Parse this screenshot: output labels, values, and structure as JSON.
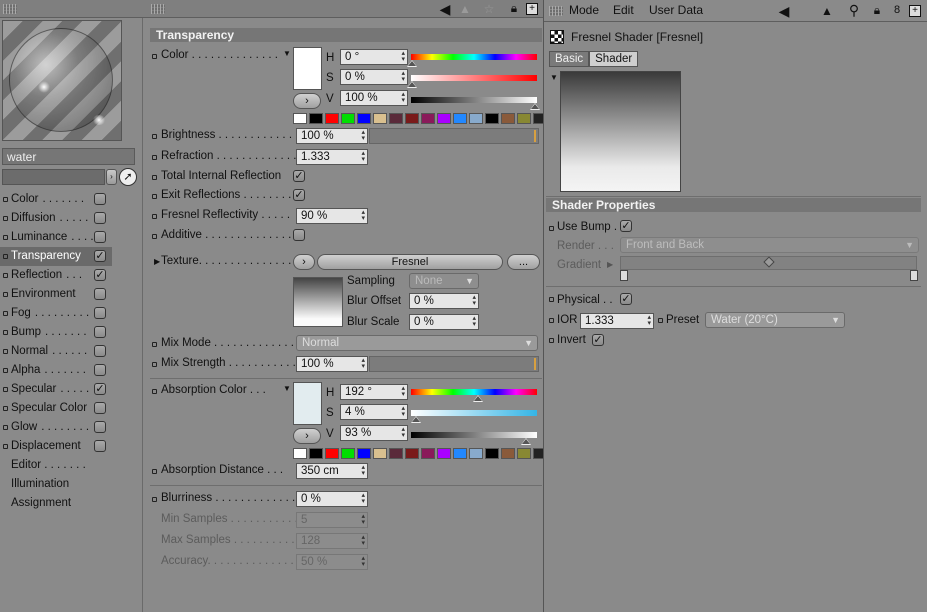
{
  "left_panel": {
    "material_name": "water",
    "channels": [
      {
        "label": "Color",
        "dots": ". . . . . . .",
        "checked": false,
        "selected": false
      },
      {
        "label": "Diffusion",
        "dots": ". . . . .",
        "checked": false,
        "selected": false
      },
      {
        "label": "Luminance",
        "dots": ". . . .",
        "checked": false,
        "selected": false
      },
      {
        "label": "Transparency",
        "dots": "",
        "checked": true,
        "selected": true
      },
      {
        "label": "Reflection",
        "dots": ". . .",
        "checked": true,
        "selected": false
      },
      {
        "label": "Environment",
        "dots": "",
        "checked": false,
        "selected": false
      },
      {
        "label": "Fog",
        "dots": ". . . . . . . . .",
        "checked": false,
        "selected": false
      },
      {
        "label": "Bump",
        "dots": ". . . . . . .",
        "checked": false,
        "selected": false
      },
      {
        "label": "Normal",
        "dots": ". . . . . .",
        "checked": false,
        "selected": false
      },
      {
        "label": "Alpha",
        "dots": ". . . . . . .",
        "checked": false,
        "selected": false
      },
      {
        "label": "Specular",
        "dots": ". . . . .",
        "checked": true,
        "selected": false
      },
      {
        "label": "Specular Color",
        "dots": "",
        "checked": false,
        "selected": false
      },
      {
        "label": "Glow",
        "dots": ". . . . . . . .",
        "checked": false,
        "selected": false
      },
      {
        "label": "Displacement",
        "dots": "",
        "checked": false,
        "selected": false
      }
    ],
    "extra_items": [
      "Editor . . . . . . .",
      "Illumination",
      "Assignment"
    ]
  },
  "transparency": {
    "header": "Transparency",
    "color_label": "Color . . . . . . . . . . . . . .",
    "h_label": "H",
    "h_value": "0 °",
    "s_label": "S",
    "s_value": "0 %",
    "v_label": "V",
    "v_value": "100 %",
    "brightness_label": "Brightness . . . . . . . . . . . . .",
    "brightness_value": "100 %",
    "refraction_label": "Refraction . . . . . . . . . . . . . .",
    "refraction_value": "1.333",
    "tir_label": "Total Internal Reflection",
    "tir_checked": true,
    "exit_label": "Exit Reflections . . . . . . . .",
    "exit_checked": true,
    "fresnel_label": "Fresnel Reflectivity . . . . .",
    "fresnel_value": "90 %",
    "additive_label": "Additive . . . . . . . . . . . . . . . .",
    "additive_checked": false,
    "texture_label": "Texture. . . . . . . . . . . . . . . .",
    "texture_shader": "Fresnel",
    "texture_more": "...",
    "sampling_label": "Sampling",
    "sampling_value": "None",
    "blur_offset_label": "Blur Offset",
    "blur_offset_value": "0 %",
    "blur_scale_label": "Blur Scale",
    "blur_scale_value": "0 %",
    "mix_mode_label": "Mix Mode . . . . . . . . . . . . . .",
    "mix_mode_value": "Normal",
    "mix_strength_label": "Mix Strength . . . . . . . . . . .",
    "mix_strength_value": "100 %",
    "absorption_color_label": "Absorption Color . . .",
    "abs_h_value": "192 °",
    "abs_s_value": "4 %",
    "abs_v_value": "93 %",
    "absorption_distance_label": "Absorption Distance . . .",
    "absorption_distance_value": "350 cm",
    "blurriness_label": "Blurriness . . . . . . . . . . . . .",
    "blurriness_value": "0 %",
    "min_samples_label": "Min Samples . . . . . . . . . . .",
    "min_samples_value": "5",
    "max_samples_label": "Max Samples . . . . . . . . . . .",
    "max_samples_value": "128",
    "accuracy_label": "Accuracy. . . . . . . . . . . . . . .",
    "accuracy_value": "50 %",
    "palette_colors": [
      "#ffffff",
      "#000000",
      "#ff0000",
      "#00dd00",
      "#0000ff",
      "#d9c08f",
      "#5a2a3a",
      "#7a1a1a",
      "#8a1a5a",
      "#aa00ff",
      "#2288ff",
      "#88aacc",
      "#000000",
      "#8a5a3a",
      "#888833",
      "#222222"
    ]
  },
  "right_panel": {
    "menu": [
      "Mode",
      "Edit",
      "User Data"
    ],
    "shader_title": "Fresnel Shader [Fresnel]",
    "tabs": [
      "Basic",
      "Shader"
    ],
    "shader_props_header": "Shader Properties",
    "use_bump_label": "Use Bump . .",
    "use_bump_checked": true,
    "render_label": "Render . . .",
    "render_value": "Front and Back",
    "gradient_label": "Gradient",
    "physical_label": "Physical . .",
    "physical_checked": true,
    "ior_label": "IOR",
    "ior_value": "1.333",
    "preset_label": "Preset",
    "preset_value": "Water (20°C)",
    "invert_label": "Invert",
    "invert_checked": true
  },
  "colors": {
    "panel_bg": "#8a8a8a",
    "header_bg": "#767676",
    "field_bg": "#e6e6e6",
    "absorption_swatch": "#e2ecef",
    "abs_sat_gradient_end": "#35b5e6"
  }
}
